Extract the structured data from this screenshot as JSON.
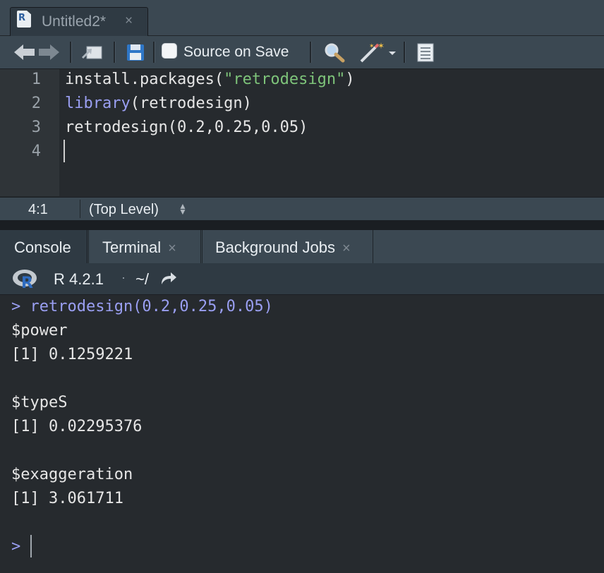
{
  "editor": {
    "tab_title": "Untitled2*",
    "tab_close": "×",
    "file_icon_letter": "R",
    "toolbar": {
      "source_on_save": "Source on Save"
    },
    "lines": [
      {
        "no": "1",
        "parts": [
          {
            "t": "install.packages(",
            "c": "plain"
          },
          {
            "t": "\"retrodesign\"",
            "c": "str"
          },
          {
            "t": ")",
            "c": "plain"
          }
        ]
      },
      {
        "no": "2",
        "parts": [
          {
            "t": "library",
            "c": "kw"
          },
          {
            "t": "(retrodesign)",
            "c": "plain"
          }
        ]
      },
      {
        "no": "3",
        "parts": [
          {
            "t": "retrodesign(0.2,0.25,0.05)",
            "c": "plain"
          }
        ]
      },
      {
        "no": "4",
        "parts": []
      }
    ],
    "status": {
      "position": "4:1",
      "scope": "(Top Level)"
    }
  },
  "console": {
    "tabs": [
      {
        "label": "Console",
        "closable": false,
        "active": true
      },
      {
        "label": "Terminal",
        "closable": true,
        "active": false
      },
      {
        "label": "Background Jobs",
        "closable": true,
        "active": false
      }
    ],
    "tab_close": "×",
    "r_version": "R 4.2.1",
    "separator": "·",
    "working_dir": "~/",
    "logo_letter": "R",
    "lines": [
      {
        "text": "> retrodesign(0.2,0.25,0.05)",
        "prompt": true
      },
      {
        "text": "$power",
        "prompt": false
      },
      {
        "text": "[1] 0.1259221",
        "prompt": false
      },
      {
        "text": "",
        "prompt": false
      },
      {
        "text": "$typeS",
        "prompt": false
      },
      {
        "text": "[1] 0.02295376",
        "prompt": false
      },
      {
        "text": "",
        "prompt": false
      },
      {
        "text": "$exaggeration",
        "prompt": false
      },
      {
        "text": "[1] 3.061711",
        "prompt": false
      }
    ],
    "input_prompt": ">"
  },
  "colors": {
    "keyword": "#9a9ff2",
    "string": "#7ec47a",
    "prompt": "#9a9ff2"
  }
}
